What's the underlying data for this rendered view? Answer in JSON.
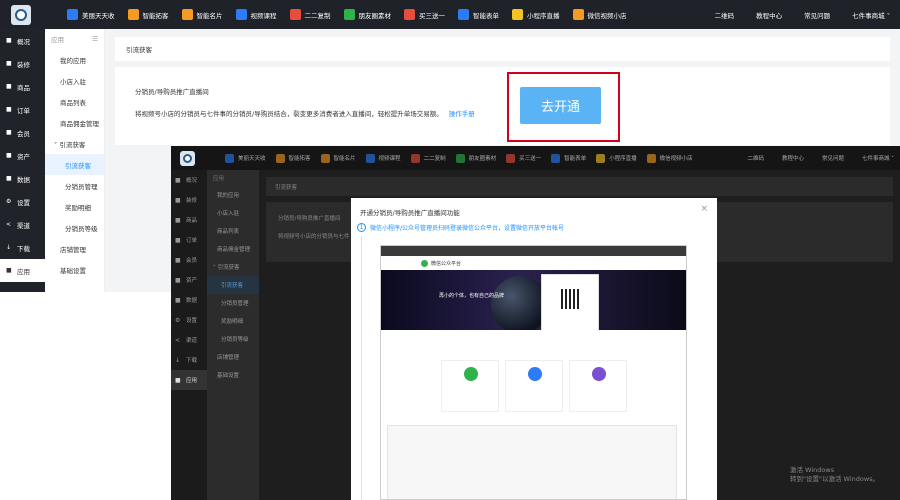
{
  "topbar": {
    "apps": [
      {
        "label": "美丽天天收",
        "color": "#2d7cf6"
      },
      {
        "label": "智能拓客",
        "color": "#f59a23"
      },
      {
        "label": "智能名片",
        "color": "#f59a23"
      },
      {
        "label": "视频课程",
        "color": "#2d7cf6"
      },
      {
        "label": "二二复制",
        "color": "#e84c3d"
      },
      {
        "label": "朋友圈素材",
        "color": "#2db34a"
      },
      {
        "label": "买三送一",
        "color": "#e84c3d"
      },
      {
        "label": "智能表单",
        "color": "#2d7cf6"
      },
      {
        "label": "小程序直播",
        "color": "#f5c623"
      },
      {
        "label": "微信视频小店",
        "color": "#f59a23"
      }
    ],
    "right": [
      "二维码",
      "教程中心",
      "常见问题",
      "七件事商城 ˅"
    ]
  },
  "sidebar": {
    "items": [
      {
        "icon": "■",
        "label": "概况"
      },
      {
        "icon": "■",
        "label": "装修"
      },
      {
        "icon": "■",
        "label": "商品"
      },
      {
        "icon": "■",
        "label": "订单"
      },
      {
        "icon": "■",
        "label": "会员"
      },
      {
        "icon": "■",
        "label": "资产"
      },
      {
        "icon": "■",
        "label": "数据"
      },
      {
        "icon": "⚙",
        "label": "设置"
      },
      {
        "icon": "<",
        "label": "渠道"
      },
      {
        "icon": "↓",
        "label": "下载"
      },
      {
        "icon": "■",
        "label": "应用"
      }
    ]
  },
  "submenu": {
    "head": "应用",
    "collapse": "☰",
    "items": [
      "我的应用",
      "小店入驻",
      "商品列表",
      "商品佣金管理",
      "˅ 引流获客",
      "引流获客",
      "分销员管理",
      "奖励明细",
      "分销员等级",
      "店铺管理",
      "基础设置"
    ]
  },
  "main": {
    "breadcrumb": "引流获客",
    "title": "分销员/导购员推广直播间",
    "desc": "将视频号小店的分销员与七件事的分销员/导购员结合，裂变更多消费者进入直播间，轻松提升单场交易额。",
    "manual_link": "操作手册",
    "open_button": "去开通"
  },
  "overlay": {
    "modal_title": "开通分销员/导购员推广直播间功能",
    "close": "×",
    "step_no": "1",
    "step_text": "微信小程序/公众号管理员扫码登录微信公众平台，设置微信开放平台帐号",
    "mock_header": "微信公众平台",
    "mock_slogan": "再小的个体，也有自己的品牌",
    "main_crumb": "引流获客",
    "main_title": "分销员/导购员推广直播间",
    "main_desc": "将视频号小店的分销员与七件"
  },
  "watermark": {
    "line1": "激活 Windows",
    "line2": "转到\"设置\"以激活 Windows。"
  }
}
